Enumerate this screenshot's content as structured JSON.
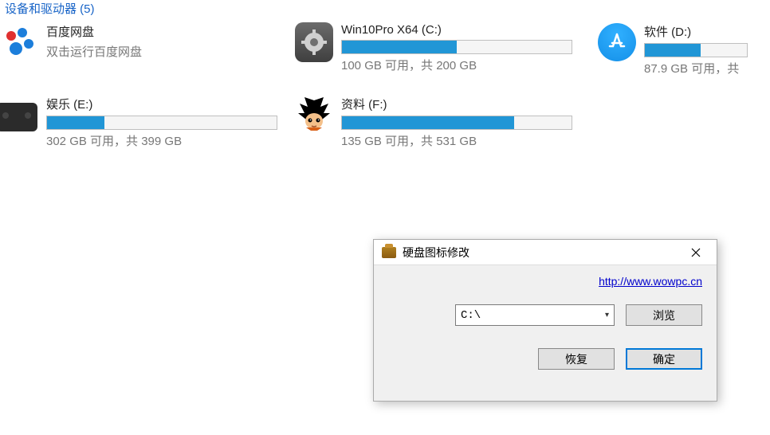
{
  "header": "设备和驱动器 (5)",
  "drives": {
    "baidu": {
      "name": "百度网盘",
      "sub": "双击运行百度网盘"
    },
    "c": {
      "name": "Win10Pro X64 (C:)",
      "stats": "100 GB 可用，共 200 GB",
      "used_pct": 50
    },
    "d": {
      "name": "软件 (D:)",
      "stats": "87.9 GB 可用，共",
      "used_pct": 55
    },
    "e": {
      "name": "娱乐 (E:)",
      "stats": "302 GB 可用，共 399 GB",
      "used_pct": 25
    },
    "f": {
      "name": "资料 (F:)",
      "stats": "135 GB 可用，共 531 GB",
      "used_pct": 75
    }
  },
  "dialog": {
    "title": "硬盘图标修改",
    "link_text": "http://www.wowpc.cn",
    "link_href": "http://www.wowpc.cn",
    "combo_value": "C:\\",
    "browse": "浏览",
    "restore": "恢复",
    "ok": "确定"
  }
}
